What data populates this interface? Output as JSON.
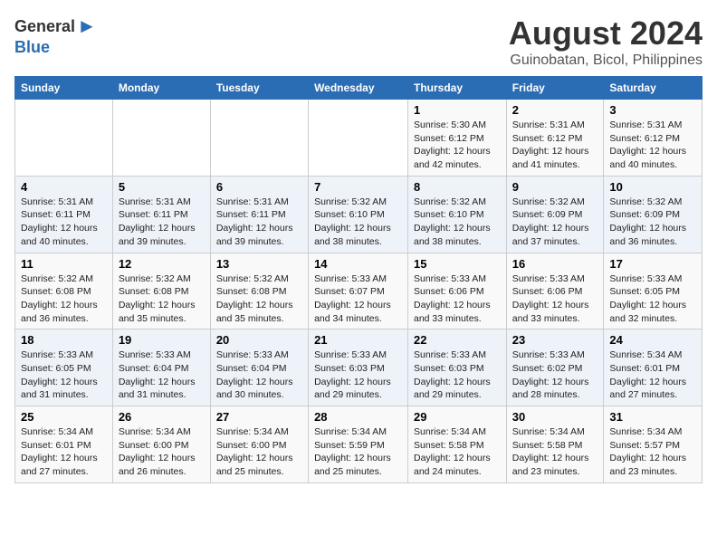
{
  "logo": {
    "general": "General",
    "blue": "Blue"
  },
  "title": "August 2024",
  "subtitle": "Guinobatan, Bicol, Philippines",
  "headers": [
    "Sunday",
    "Monday",
    "Tuesday",
    "Wednesday",
    "Thursday",
    "Friday",
    "Saturday"
  ],
  "weeks": [
    [
      {
        "day": "",
        "info": ""
      },
      {
        "day": "",
        "info": ""
      },
      {
        "day": "",
        "info": ""
      },
      {
        "day": "",
        "info": ""
      },
      {
        "day": "1",
        "info": "Sunrise: 5:30 AM\nSunset: 6:12 PM\nDaylight: 12 hours\nand 42 minutes."
      },
      {
        "day": "2",
        "info": "Sunrise: 5:31 AM\nSunset: 6:12 PM\nDaylight: 12 hours\nand 41 minutes."
      },
      {
        "day": "3",
        "info": "Sunrise: 5:31 AM\nSunset: 6:12 PM\nDaylight: 12 hours\nand 40 minutes."
      }
    ],
    [
      {
        "day": "4",
        "info": "Sunrise: 5:31 AM\nSunset: 6:11 PM\nDaylight: 12 hours\nand 40 minutes."
      },
      {
        "day": "5",
        "info": "Sunrise: 5:31 AM\nSunset: 6:11 PM\nDaylight: 12 hours\nand 39 minutes."
      },
      {
        "day": "6",
        "info": "Sunrise: 5:31 AM\nSunset: 6:11 PM\nDaylight: 12 hours\nand 39 minutes."
      },
      {
        "day": "7",
        "info": "Sunrise: 5:32 AM\nSunset: 6:10 PM\nDaylight: 12 hours\nand 38 minutes."
      },
      {
        "day": "8",
        "info": "Sunrise: 5:32 AM\nSunset: 6:10 PM\nDaylight: 12 hours\nand 38 minutes."
      },
      {
        "day": "9",
        "info": "Sunrise: 5:32 AM\nSunset: 6:09 PM\nDaylight: 12 hours\nand 37 minutes."
      },
      {
        "day": "10",
        "info": "Sunrise: 5:32 AM\nSunset: 6:09 PM\nDaylight: 12 hours\nand 36 minutes."
      }
    ],
    [
      {
        "day": "11",
        "info": "Sunrise: 5:32 AM\nSunset: 6:08 PM\nDaylight: 12 hours\nand 36 minutes."
      },
      {
        "day": "12",
        "info": "Sunrise: 5:32 AM\nSunset: 6:08 PM\nDaylight: 12 hours\nand 35 minutes."
      },
      {
        "day": "13",
        "info": "Sunrise: 5:32 AM\nSunset: 6:08 PM\nDaylight: 12 hours\nand 35 minutes."
      },
      {
        "day": "14",
        "info": "Sunrise: 5:33 AM\nSunset: 6:07 PM\nDaylight: 12 hours\nand 34 minutes."
      },
      {
        "day": "15",
        "info": "Sunrise: 5:33 AM\nSunset: 6:06 PM\nDaylight: 12 hours\nand 33 minutes."
      },
      {
        "day": "16",
        "info": "Sunrise: 5:33 AM\nSunset: 6:06 PM\nDaylight: 12 hours\nand 33 minutes."
      },
      {
        "day": "17",
        "info": "Sunrise: 5:33 AM\nSunset: 6:05 PM\nDaylight: 12 hours\nand 32 minutes."
      }
    ],
    [
      {
        "day": "18",
        "info": "Sunrise: 5:33 AM\nSunset: 6:05 PM\nDaylight: 12 hours\nand 31 minutes."
      },
      {
        "day": "19",
        "info": "Sunrise: 5:33 AM\nSunset: 6:04 PM\nDaylight: 12 hours\nand 31 minutes."
      },
      {
        "day": "20",
        "info": "Sunrise: 5:33 AM\nSunset: 6:04 PM\nDaylight: 12 hours\nand 30 minutes."
      },
      {
        "day": "21",
        "info": "Sunrise: 5:33 AM\nSunset: 6:03 PM\nDaylight: 12 hours\nand 29 minutes."
      },
      {
        "day": "22",
        "info": "Sunrise: 5:33 AM\nSunset: 6:03 PM\nDaylight: 12 hours\nand 29 minutes."
      },
      {
        "day": "23",
        "info": "Sunrise: 5:33 AM\nSunset: 6:02 PM\nDaylight: 12 hours\nand 28 minutes."
      },
      {
        "day": "24",
        "info": "Sunrise: 5:34 AM\nSunset: 6:01 PM\nDaylight: 12 hours\nand 27 minutes."
      }
    ],
    [
      {
        "day": "25",
        "info": "Sunrise: 5:34 AM\nSunset: 6:01 PM\nDaylight: 12 hours\nand 27 minutes."
      },
      {
        "day": "26",
        "info": "Sunrise: 5:34 AM\nSunset: 6:00 PM\nDaylight: 12 hours\nand 26 minutes."
      },
      {
        "day": "27",
        "info": "Sunrise: 5:34 AM\nSunset: 6:00 PM\nDaylight: 12 hours\nand 25 minutes."
      },
      {
        "day": "28",
        "info": "Sunrise: 5:34 AM\nSunset: 5:59 PM\nDaylight: 12 hours\nand 25 minutes."
      },
      {
        "day": "29",
        "info": "Sunrise: 5:34 AM\nSunset: 5:58 PM\nDaylight: 12 hours\nand 24 minutes."
      },
      {
        "day": "30",
        "info": "Sunrise: 5:34 AM\nSunset: 5:58 PM\nDaylight: 12 hours\nand 23 minutes."
      },
      {
        "day": "31",
        "info": "Sunrise: 5:34 AM\nSunset: 5:57 PM\nDaylight: 12 hours\nand 23 minutes."
      }
    ]
  ]
}
